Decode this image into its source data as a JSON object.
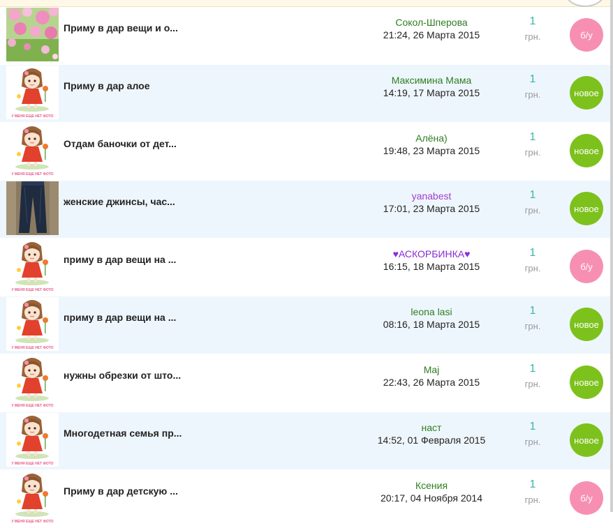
{
  "colors": {
    "used_badge": "#f78fb3",
    "new_badge": "#7dc11c",
    "author_green": "#2e7d1f",
    "author_purple": "#a43dcc",
    "row_alt": "#eef6fd"
  },
  "rows": [
    {
      "thumb": "flowers-photo",
      "title": "Приму в дар вещи и о...",
      "author": "Сокол-Шперова",
      "date": "21:24, 26 Марта 2015",
      "qty": "1",
      "unit": "грн.",
      "badge": "б/у",
      "badge_kind": "used"
    },
    {
      "thumb": "no-photo-doll",
      "thumb_caption": "У МЕНЯ ЕЩЕ НЕТ ФОТО",
      "title": "Приму в дар алое",
      "author": "Максимина Мама",
      "date": "14:19, 17 Марта 2015",
      "qty": "1",
      "unit": "грн.",
      "badge": "новое",
      "badge_kind": "new"
    },
    {
      "thumb": "no-photo-doll",
      "thumb_caption": "У МЕНЯ ЕЩЕ НЕТ ФОТО",
      "title": "Отдам баночки от дет...",
      "author": "Алёна)",
      "date": "19:48, 23 Марта 2015",
      "qty": "1",
      "unit": "грн.",
      "badge": "новое",
      "badge_kind": "new"
    },
    {
      "thumb": "jeans-photo",
      "title": "женские джинсы, час...",
      "author": "yanabest",
      "author_color": "purple",
      "date": "17:01, 23 Марта 2015",
      "qty": "1",
      "unit": "грн.",
      "badge": "новое",
      "badge_kind": "new"
    },
    {
      "thumb": "no-photo-doll",
      "thumb_caption": "У МЕНЯ ЕЩЕ НЕТ ФОТО",
      "title": "приму в дар вещи на ...",
      "author": "♥АСКОРБИНКА♥",
      "author_color": "violet",
      "date": "16:15, 18 Марта 2015",
      "qty": "1",
      "unit": "грн.",
      "badge": "б/у",
      "badge_kind": "used"
    },
    {
      "thumb": "no-photo-doll",
      "thumb_caption": "У МЕНЯ ЕЩЕ НЕТ ФОТО",
      "title": "приму в дар вещи на ...",
      "author": "leona lasi",
      "date": "08:16, 18 Марта 2015",
      "qty": "1",
      "unit": "грн.",
      "badge": "новое",
      "badge_kind": "new"
    },
    {
      "thumb": "no-photo-doll",
      "thumb_caption": "У МЕНЯ ЕЩЕ НЕТ ФОТО",
      "title": "нужны обрезки от што...",
      "author": "Maj",
      "date": "22:43, 26 Марта 2015",
      "qty": "1",
      "unit": "грн.",
      "badge": "новое",
      "badge_kind": "new"
    },
    {
      "thumb": "no-photo-doll",
      "thumb_caption": "У МЕНЯ ЕЩЕ НЕТ ФОТО",
      "title": "Многодетная семья пр...",
      "author": "наст",
      "date": "14:52, 01 Февраля 2015",
      "qty": "1",
      "unit": "грн.",
      "badge": "новое",
      "badge_kind": "new"
    },
    {
      "thumb": "no-photo-doll",
      "thumb_caption": "У МЕНЯ ЕЩЕ НЕТ ФОТО",
      "title": "Приму в дар детскую ...",
      "author": "Ксения",
      "date": "20:17, 04 Ноября 2014",
      "qty": "1",
      "unit": "грн.",
      "badge": "б/у",
      "badge_kind": "used"
    }
  ]
}
